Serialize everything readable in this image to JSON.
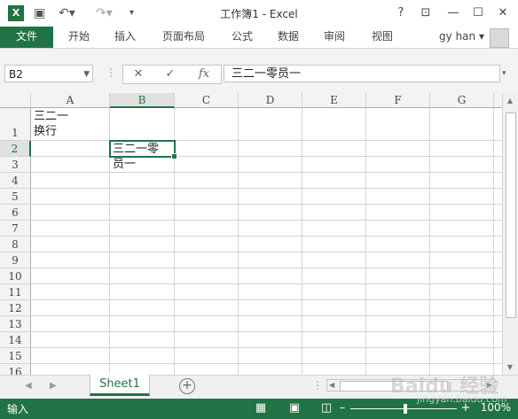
{
  "window": {
    "title": "工作簿1 - Excel"
  },
  "quick_access": {
    "logo_text": "X"
  },
  "ribbon": {
    "tabs": [
      "文件",
      "开始",
      "插入",
      "页面布局",
      "公式",
      "数据",
      "审阅",
      "视图"
    ],
    "user": "gy han"
  },
  "formula_bar": {
    "name_box": "B2",
    "cancel_icon": "✕",
    "enter_icon": "✓",
    "fx_label": "fx",
    "content": "三二一零员一"
  },
  "sheet": {
    "columns": [
      "A",
      "B",
      "C",
      "D",
      "E",
      "F",
      "G"
    ],
    "rows": [
      "1",
      "2",
      "3",
      "4",
      "5",
      "6",
      "7",
      "8",
      "9",
      "10",
      "11",
      "12",
      "13",
      "14",
      "15",
      "16"
    ],
    "cells": {
      "A1": "三二一\n换行",
      "B2": "三二一零\n员一"
    },
    "active_cell": "B2"
  },
  "tabs_bar": {
    "sheet_name": "Sheet1",
    "add_sheet": "+"
  },
  "status": {
    "mode": "输入",
    "zoom": "100%"
  },
  "watermark": {
    "logo": "Baidu 经验",
    "url": "jingyan.baidu.com"
  },
  "colors": {
    "accent": "#217346"
  }
}
